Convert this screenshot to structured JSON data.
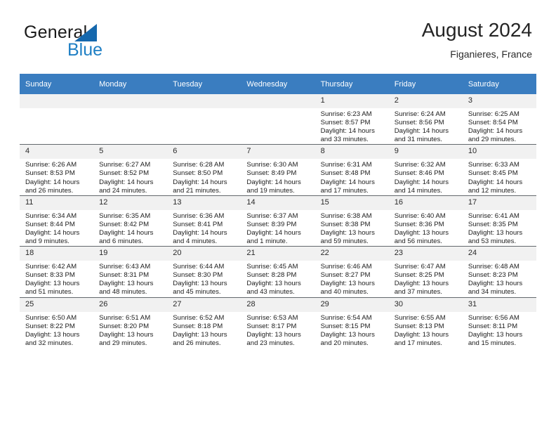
{
  "brand": {
    "line1": "General",
    "line2": "Blue",
    "logo_color": "#1568ad",
    "accent_color": "#1f7fc4"
  },
  "header": {
    "title": "August 2024",
    "location": "Figanieres, France"
  },
  "theme": {
    "header_row_bg": "#3a7dc0",
    "daynum_bg": "#f1f1f1",
    "cell_border": "#63686d"
  },
  "weekdays": [
    "Sunday",
    "Monday",
    "Tuesday",
    "Wednesday",
    "Thursday",
    "Friday",
    "Saturday"
  ],
  "weeks": [
    [
      {
        "day": "",
        "empty": true
      },
      {
        "day": "",
        "empty": true
      },
      {
        "day": "",
        "empty": true
      },
      {
        "day": "",
        "empty": true
      },
      {
        "day": "1",
        "sunrise": "Sunrise: 6:23 AM",
        "sunset": "Sunset: 8:57 PM",
        "daylight": "Daylight: 14 hours and 33 minutes."
      },
      {
        "day": "2",
        "sunrise": "Sunrise: 6:24 AM",
        "sunset": "Sunset: 8:56 PM",
        "daylight": "Daylight: 14 hours and 31 minutes."
      },
      {
        "day": "3",
        "sunrise": "Sunrise: 6:25 AM",
        "sunset": "Sunset: 8:54 PM",
        "daylight": "Daylight: 14 hours and 29 minutes."
      }
    ],
    [
      {
        "day": "4",
        "sunrise": "Sunrise: 6:26 AM",
        "sunset": "Sunset: 8:53 PM",
        "daylight": "Daylight: 14 hours and 26 minutes."
      },
      {
        "day": "5",
        "sunrise": "Sunrise: 6:27 AM",
        "sunset": "Sunset: 8:52 PM",
        "daylight": "Daylight: 14 hours and 24 minutes."
      },
      {
        "day": "6",
        "sunrise": "Sunrise: 6:28 AM",
        "sunset": "Sunset: 8:50 PM",
        "daylight": "Daylight: 14 hours and 21 minutes."
      },
      {
        "day": "7",
        "sunrise": "Sunrise: 6:30 AM",
        "sunset": "Sunset: 8:49 PM",
        "daylight": "Daylight: 14 hours and 19 minutes."
      },
      {
        "day": "8",
        "sunrise": "Sunrise: 6:31 AM",
        "sunset": "Sunset: 8:48 PM",
        "daylight": "Daylight: 14 hours and 17 minutes."
      },
      {
        "day": "9",
        "sunrise": "Sunrise: 6:32 AM",
        "sunset": "Sunset: 8:46 PM",
        "daylight": "Daylight: 14 hours and 14 minutes."
      },
      {
        "day": "10",
        "sunrise": "Sunrise: 6:33 AM",
        "sunset": "Sunset: 8:45 PM",
        "daylight": "Daylight: 14 hours and 12 minutes."
      }
    ],
    [
      {
        "day": "11",
        "sunrise": "Sunrise: 6:34 AM",
        "sunset": "Sunset: 8:44 PM",
        "daylight": "Daylight: 14 hours and 9 minutes."
      },
      {
        "day": "12",
        "sunrise": "Sunrise: 6:35 AM",
        "sunset": "Sunset: 8:42 PM",
        "daylight": "Daylight: 14 hours and 6 minutes."
      },
      {
        "day": "13",
        "sunrise": "Sunrise: 6:36 AM",
        "sunset": "Sunset: 8:41 PM",
        "daylight": "Daylight: 14 hours and 4 minutes."
      },
      {
        "day": "14",
        "sunrise": "Sunrise: 6:37 AM",
        "sunset": "Sunset: 8:39 PM",
        "daylight": "Daylight: 14 hours and 1 minute."
      },
      {
        "day": "15",
        "sunrise": "Sunrise: 6:38 AM",
        "sunset": "Sunset: 8:38 PM",
        "daylight": "Daylight: 13 hours and 59 minutes."
      },
      {
        "day": "16",
        "sunrise": "Sunrise: 6:40 AM",
        "sunset": "Sunset: 8:36 PM",
        "daylight": "Daylight: 13 hours and 56 minutes."
      },
      {
        "day": "17",
        "sunrise": "Sunrise: 6:41 AM",
        "sunset": "Sunset: 8:35 PM",
        "daylight": "Daylight: 13 hours and 53 minutes."
      }
    ],
    [
      {
        "day": "18",
        "sunrise": "Sunrise: 6:42 AM",
        "sunset": "Sunset: 8:33 PM",
        "daylight": "Daylight: 13 hours and 51 minutes."
      },
      {
        "day": "19",
        "sunrise": "Sunrise: 6:43 AM",
        "sunset": "Sunset: 8:31 PM",
        "daylight": "Daylight: 13 hours and 48 minutes."
      },
      {
        "day": "20",
        "sunrise": "Sunrise: 6:44 AM",
        "sunset": "Sunset: 8:30 PM",
        "daylight": "Daylight: 13 hours and 45 minutes."
      },
      {
        "day": "21",
        "sunrise": "Sunrise: 6:45 AM",
        "sunset": "Sunset: 8:28 PM",
        "daylight": "Daylight: 13 hours and 43 minutes."
      },
      {
        "day": "22",
        "sunrise": "Sunrise: 6:46 AM",
        "sunset": "Sunset: 8:27 PM",
        "daylight": "Daylight: 13 hours and 40 minutes."
      },
      {
        "day": "23",
        "sunrise": "Sunrise: 6:47 AM",
        "sunset": "Sunset: 8:25 PM",
        "daylight": "Daylight: 13 hours and 37 minutes."
      },
      {
        "day": "24",
        "sunrise": "Sunrise: 6:48 AM",
        "sunset": "Sunset: 8:23 PM",
        "daylight": "Daylight: 13 hours and 34 minutes."
      }
    ],
    [
      {
        "day": "25",
        "sunrise": "Sunrise: 6:50 AM",
        "sunset": "Sunset: 8:22 PM",
        "daylight": "Daylight: 13 hours and 32 minutes."
      },
      {
        "day": "26",
        "sunrise": "Sunrise: 6:51 AM",
        "sunset": "Sunset: 8:20 PM",
        "daylight": "Daylight: 13 hours and 29 minutes."
      },
      {
        "day": "27",
        "sunrise": "Sunrise: 6:52 AM",
        "sunset": "Sunset: 8:18 PM",
        "daylight": "Daylight: 13 hours and 26 minutes."
      },
      {
        "day": "28",
        "sunrise": "Sunrise: 6:53 AM",
        "sunset": "Sunset: 8:17 PM",
        "daylight": "Daylight: 13 hours and 23 minutes."
      },
      {
        "day": "29",
        "sunrise": "Sunrise: 6:54 AM",
        "sunset": "Sunset: 8:15 PM",
        "daylight": "Daylight: 13 hours and 20 minutes."
      },
      {
        "day": "30",
        "sunrise": "Sunrise: 6:55 AM",
        "sunset": "Sunset: 8:13 PM",
        "daylight": "Daylight: 13 hours and 17 minutes."
      },
      {
        "day": "31",
        "sunrise": "Sunrise: 6:56 AM",
        "sunset": "Sunset: 8:11 PM",
        "daylight": "Daylight: 13 hours and 15 minutes."
      }
    ]
  ]
}
